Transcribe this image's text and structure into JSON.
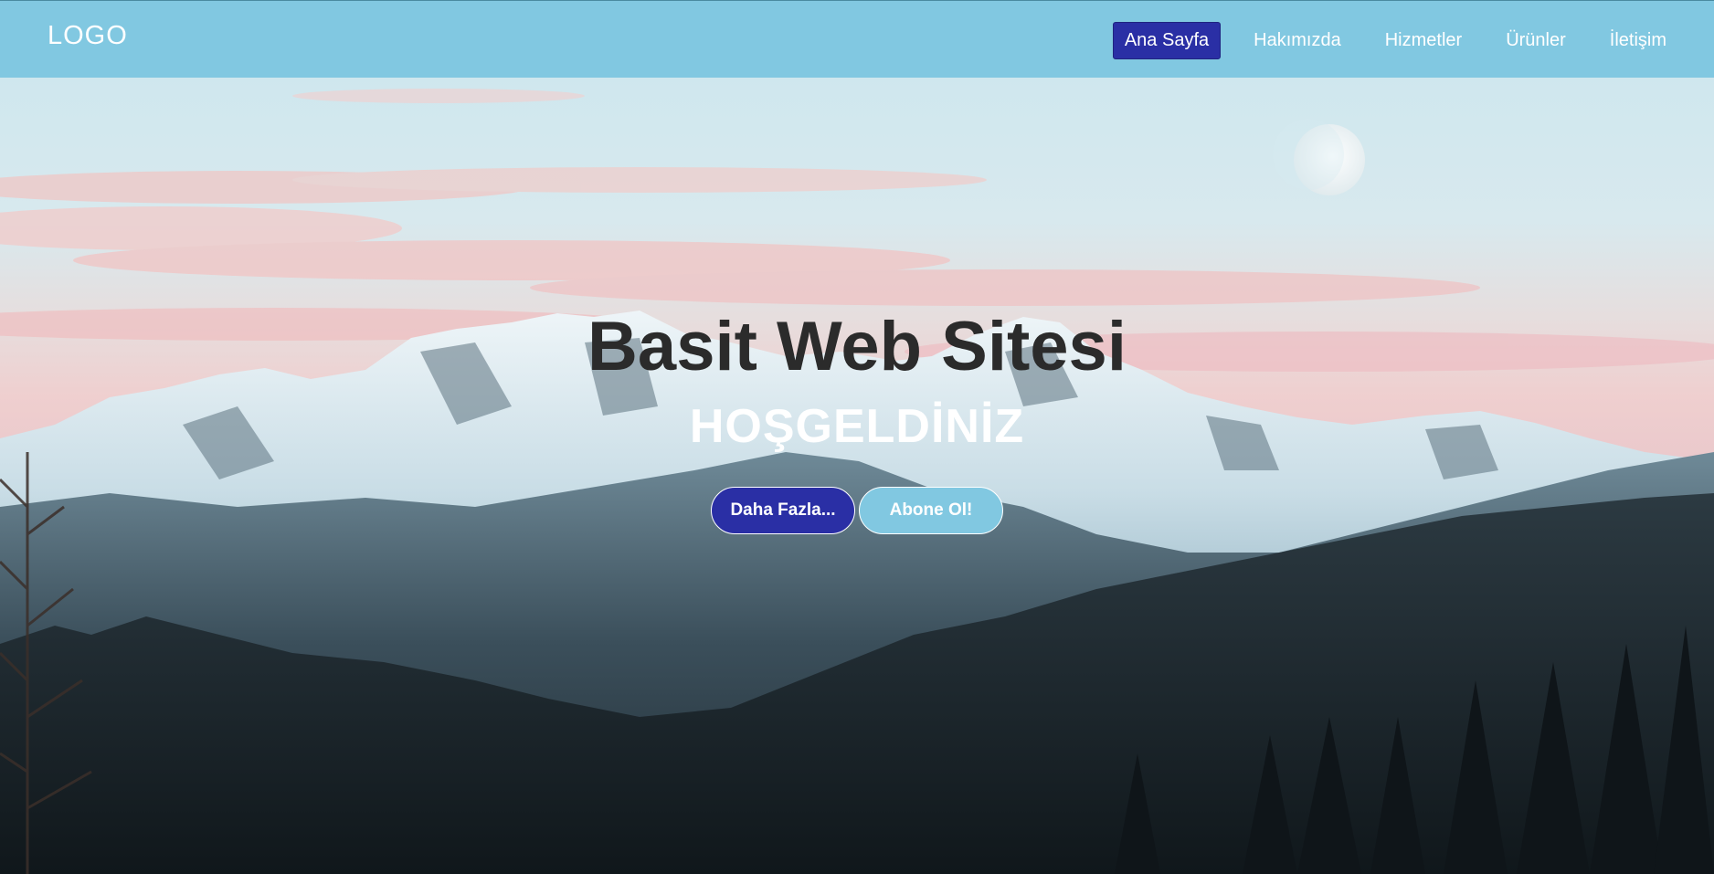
{
  "header": {
    "logo": "LOGO",
    "nav": [
      {
        "label": "Ana Sayfa",
        "active": true
      },
      {
        "label": "Hakımızda",
        "active": false
      },
      {
        "label": "Hizmetler",
        "active": false
      },
      {
        "label": "Ürünler",
        "active": false
      },
      {
        "label": "İletişim",
        "active": false
      }
    ]
  },
  "hero": {
    "title": "Basit Web Sitesi",
    "subtitle": "HOŞGELDİNİZ",
    "primary_button": "Daha Fazla...",
    "secondary_button": "Abone Ol!",
    "background_image": "snowy-mountain-landscape-with-moon"
  },
  "colors": {
    "header_bg": "#81c8e1",
    "accent": "#2a2fa5",
    "title_text": "#2b2b2b",
    "subtitle_text": "#ffffff"
  }
}
